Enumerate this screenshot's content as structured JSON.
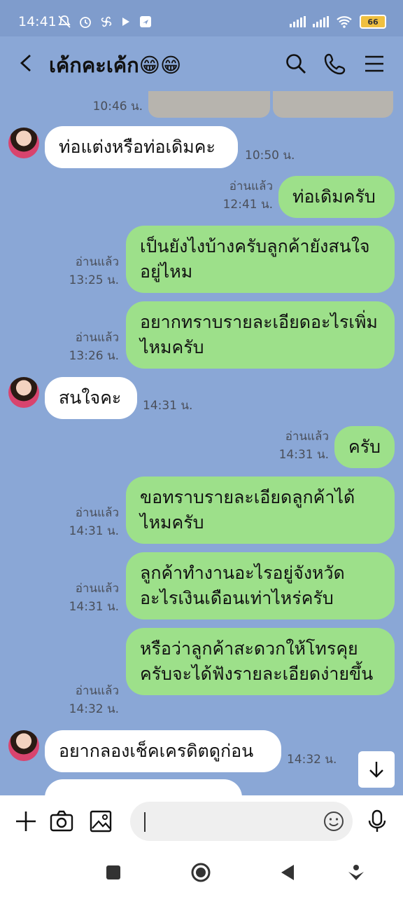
{
  "status": {
    "time": "14:41",
    "battery": "66",
    "icons": [
      "mute-bell-icon",
      "alarm-icon",
      "fan-icon",
      "play-icon",
      "app-icon"
    ]
  },
  "header": {
    "title": "เค้กคะเค้ก😁😁",
    "icons": [
      "back-arrow-icon",
      "search-icon",
      "phone-icon",
      "menu-icon"
    ]
  },
  "messages": [
    {
      "side": "out",
      "text": "",
      "time": "10:46 น.",
      "read": "",
      "kind": "photos"
    },
    {
      "side": "in",
      "text": "ท่อแต่งหรือท่อเดิมคะ",
      "time": "10:50 น."
    },
    {
      "side": "out",
      "text": "ท่อเดิมครับ",
      "read": "อ่านแล้ว",
      "time": "12:41 น."
    },
    {
      "side": "out",
      "text": "เป็นยังไงบ้างครับลูกค้ายังสนใจอยู่ไหม",
      "read": "อ่านแล้ว",
      "time": "13:25 น."
    },
    {
      "side": "out",
      "text": "อยากทราบรายละเอียดอะไรเพิ่มไหมครับ",
      "read": "อ่านแล้ว",
      "time": "13:26 น."
    },
    {
      "side": "in",
      "text": "สนใจคะ",
      "time": "14:31 น."
    },
    {
      "side": "out",
      "text": "ครับ",
      "read": "อ่านแล้ว",
      "time": "14:31 น."
    },
    {
      "side": "out",
      "text": "ขอทราบรายละเอียดลูกค้าได้ไหมครับ",
      "read": "อ่านแล้ว",
      "time": "14:31 น."
    },
    {
      "side": "out",
      "text": "ลูกค้าทำงานอะไรอยู่จังหวัดอะไรเงินเดือนเท่าไหร่ครับ",
      "read": "อ่านแล้ว",
      "time": "14:31 น."
    },
    {
      "side": "out",
      "text": "หรือว่าลูกค้าสะดวกให้โทรคุยครับจะได้ฟังรายละเอียดง่ายขึ้น",
      "read": "อ่านแล้ว",
      "time": "14:32 น."
    },
    {
      "side": "in",
      "text": "อยากลองเช็คเครดิตดูก่อน",
      "time": "14:32 น."
    },
    {
      "side": "in",
      "text": "",
      "time": "",
      "kind": "partial"
    }
  ],
  "input": {
    "placeholder": "",
    "icons": [
      "plus-icon",
      "camera-icon",
      "image-icon",
      "emoji-icon",
      "microphone-icon"
    ]
  },
  "nav": [
    "square-icon",
    "home-circle-icon",
    "back-triangle-icon",
    "assistant-icon"
  ],
  "colors": {
    "chat_bg": "#8aa7d6",
    "bubble_out": "#9de08a",
    "bubble_in": "#ffffff",
    "read_text": "#4a4f5a"
  }
}
